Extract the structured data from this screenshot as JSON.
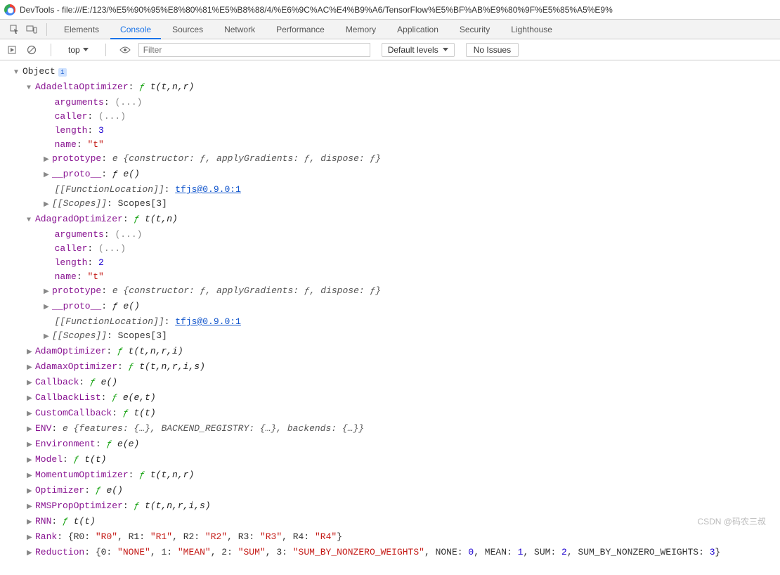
{
  "window": {
    "title": "DevTools - file:///E:/123/%E5%90%95%E8%80%81%E5%B8%88/4/%E6%9C%AC%E4%B9%A6/TensorFlow%E5%BF%AB%E9%80%9F%E5%85%A5%E9%"
  },
  "tabs": {
    "items": [
      "Elements",
      "Console",
      "Sources",
      "Network",
      "Performance",
      "Memory",
      "Application",
      "Security",
      "Lighthouse"
    ],
    "active": "Console"
  },
  "toolbar": {
    "context": "top",
    "filterPlaceholder": "Filter",
    "levels": "Default levels",
    "issues": "No Issues"
  },
  "console": {
    "root": "Object",
    "adadelta": {
      "key": "AdadeltaOptimizer",
      "sig": "t(t,n,r)",
      "arguments": "arguments",
      "argumentsVal": "(...)",
      "caller": "caller",
      "callerVal": "(...)",
      "length": "length",
      "lengthVal": "3",
      "name": "name",
      "nameVal": "\"t\"",
      "prototype": "prototype",
      "prototypeVal": "e {constructor: ƒ, applyGradients: ƒ, dispose: ƒ}",
      "proto": "__proto__",
      "protoVal": "ƒ e()",
      "funcLoc": "[[FunctionLocation]]",
      "funcLocVal": "tfjs@0.9.0:1",
      "scopes": "[[Scopes]]",
      "scopesVal": "Scopes[3]"
    },
    "adagrad": {
      "key": "AdagradOptimizer",
      "sig": "t(t,n)",
      "arguments": "arguments",
      "argumentsVal": "(...)",
      "caller": "caller",
      "callerVal": "(...)",
      "length": "length",
      "lengthVal": "2",
      "name": "name",
      "nameVal": "\"t\"",
      "prototype": "prototype",
      "prototypeVal": "e {constructor: ƒ, applyGradients: ƒ, dispose: ƒ}",
      "proto": "__proto__",
      "protoVal": "ƒ e()",
      "funcLoc": "[[FunctionLocation]]",
      "funcLocVal": "tfjs@0.9.0:1",
      "scopes": "[[Scopes]]",
      "scopesVal": "Scopes[3]"
    },
    "simple": {
      "adam": {
        "key": "AdamOptimizer",
        "sig": "t(t,n,r,i)"
      },
      "adamax": {
        "key": "AdamaxOptimizer",
        "sig": "t(t,n,r,i,s)"
      },
      "callback": {
        "key": "Callback",
        "sig": "e()"
      },
      "callbackList": {
        "key": "CallbackList",
        "sig": "e(e,t)"
      },
      "custom": {
        "key": "CustomCallback",
        "sig": "t(t)"
      },
      "env": {
        "key": "ENV",
        "val": "e {features: {…}, BACKEND_REGISTRY: {…}, backends: {…}}"
      },
      "environment": {
        "key": "Environment",
        "sig": "e(e)"
      },
      "model": {
        "key": "Model",
        "sig": "t(t)"
      },
      "momentum": {
        "key": "MomentumOptimizer",
        "sig": "t(t,n,r)"
      },
      "optimizer": {
        "key": "Optimizer",
        "sig": "e()"
      },
      "rms": {
        "key": "RMSPropOptimizer",
        "sig": "t(t,n,r,i,s)"
      },
      "rnn": {
        "key": "RNN",
        "sig": "t(t)"
      },
      "rank": {
        "key": "Rank",
        "prefix": "{R0: ",
        "r0": "\"R0\"",
        "r1": "\"R1\"",
        "r2": "\"R2\"",
        "r3": "\"R3\"",
        "r4": "\"R4\"",
        "mid": ", R1: ",
        "mid2": ", R2: ",
        "mid3": ", R3: ",
        "mid4": ", R4: ",
        "suffix": "}"
      },
      "reduction": {
        "key": "Reduction",
        "p0": "{0: ",
        "v0": "\"NONE\"",
        "p1": ", 1: ",
        "v1": "\"MEAN\"",
        "p2": ", 2: ",
        "v2": "\"SUM\"",
        "p3": ", 3: ",
        "v3": "\"SUM_BY_NONZERO_WEIGHTS\"",
        "p4": ", NONE: ",
        "n0": "0",
        "p5": ", MEAN: ",
        "n1": "1",
        "p6": ", SUM: ",
        "n2": "2",
        "p7": ", SUM_BY_NONZERO_WEIGHTS: ",
        "n3": "3",
        "suffix": "}"
      }
    }
  },
  "watermark": "CSDN @码农三叔"
}
